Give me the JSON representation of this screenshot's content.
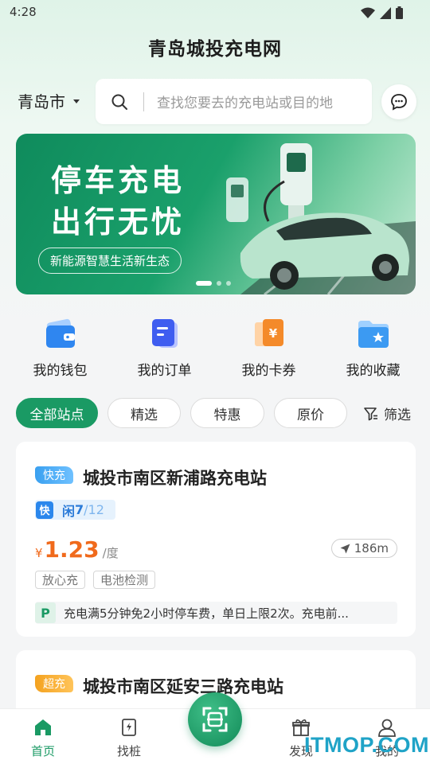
{
  "status_bar": {
    "time": "4:28",
    "icons": [
      "wifi-icon",
      "signal-icon",
      "battery-icon"
    ]
  },
  "app": {
    "title": "青岛城投充电网"
  },
  "header": {
    "city": "青岛市",
    "search_placeholder": "查找您要去的充电站或目的地",
    "message_icon": "chat-bubble-icon"
  },
  "banner": {
    "line1": "停车充电",
    "line2": "出行无忧",
    "tag": "新能源智慧生活新生态",
    "page_count": 3,
    "active_page": 1
  },
  "quick_actions": [
    {
      "label": "我的钱包",
      "icon": "wallet-icon"
    },
    {
      "label": "我的订单",
      "icon": "order-icon"
    },
    {
      "label": "我的卡券",
      "icon": "coupon-icon"
    },
    {
      "label": "我的收藏",
      "icon": "favorite-folder-icon"
    }
  ],
  "filters": {
    "chips": [
      "全部站点",
      "精选",
      "特惠",
      "原价"
    ],
    "active": "全部站点",
    "filter_label": "筛选"
  },
  "stations": [
    {
      "badge": "快充",
      "name": "城投市南区新浦路充电站",
      "avail_icon": "快",
      "avail_label": "闲",
      "avail_free": "7",
      "avail_total": "/12",
      "currency": "¥",
      "price": "1.23",
      "price_unit": "/度",
      "distance": "186m",
      "tags": [
        "放心充",
        "电池检测"
      ],
      "notice_icon": "P",
      "notice": "充电满5分钟免2小时停车费，单日上限2次。充电前..."
    },
    {
      "badge": "超充",
      "name": "城投市南区延安三路充电站"
    }
  ],
  "tab_bar": {
    "items": [
      {
        "label": "首页",
        "icon": "home-icon",
        "active": true
      },
      {
        "label": "找桩",
        "icon": "charger-icon",
        "active": false
      },
      {
        "label": "发现",
        "icon": "gift-icon",
        "active": false
      },
      {
        "label": "我的",
        "icon": "user-icon",
        "active": false
      }
    ],
    "scan_icon": "scan-icon"
  },
  "watermark": "ITMOP.COM",
  "colors": {
    "brand_green": "#1a9a64",
    "price_orange": "#f06a1c",
    "fast_blue": "#3aa0f0",
    "super_orange": "#f4a21f"
  }
}
